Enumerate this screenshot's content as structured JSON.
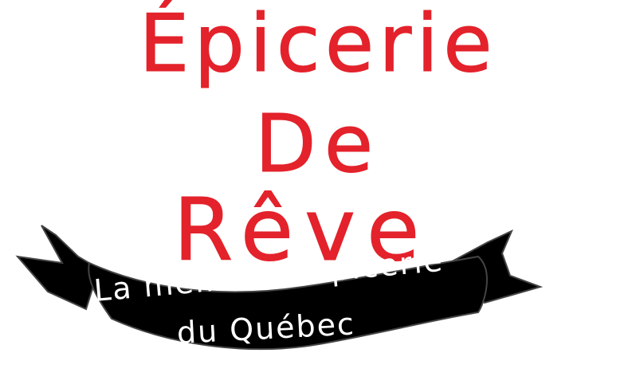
{
  "title": {
    "line1": "Épicerie",
    "line2": "De",
    "line3": "Rêve"
  },
  "banner": {
    "line1": "La meilleure épicerie",
    "line2": "du Québec"
  },
  "colors": {
    "title": "#e3222b",
    "banner": "#000000",
    "banner_text": "#ffffff",
    "background": "#ffffff"
  }
}
